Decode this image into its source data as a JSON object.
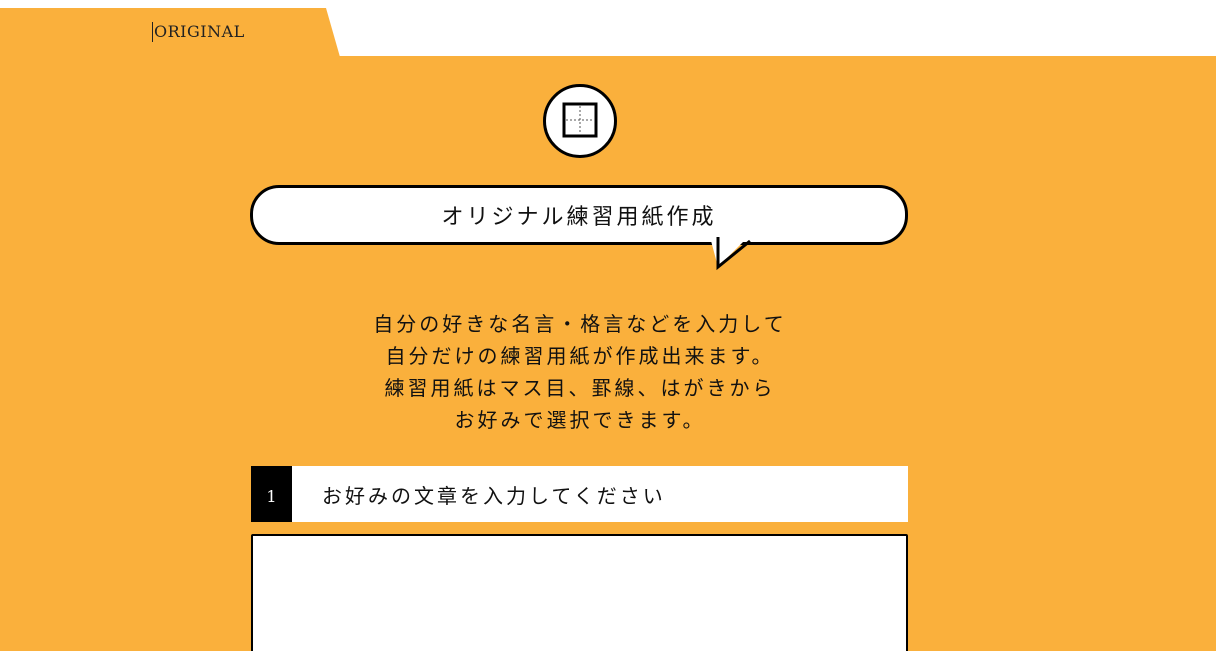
{
  "tab": {
    "label": "ORIGINAL"
  },
  "logo": {
    "icon": "grid-square-icon"
  },
  "heading": {
    "title": "オリジナル練習用紙作成"
  },
  "intro": {
    "lines": [
      "自分の好きな名言・格言などを入力して",
      "自分だけの練習用紙が作成出来ます。",
      "練習用紙はマス目、罫線、はがきから",
      "お好みで選択できます。"
    ]
  },
  "step1": {
    "number": "1",
    "title": "お好みの文章を入力してください",
    "input_value": ""
  },
  "colors": {
    "background": "#FAB03C",
    "accent": "#000000",
    "surface": "#FFFFFF"
  }
}
